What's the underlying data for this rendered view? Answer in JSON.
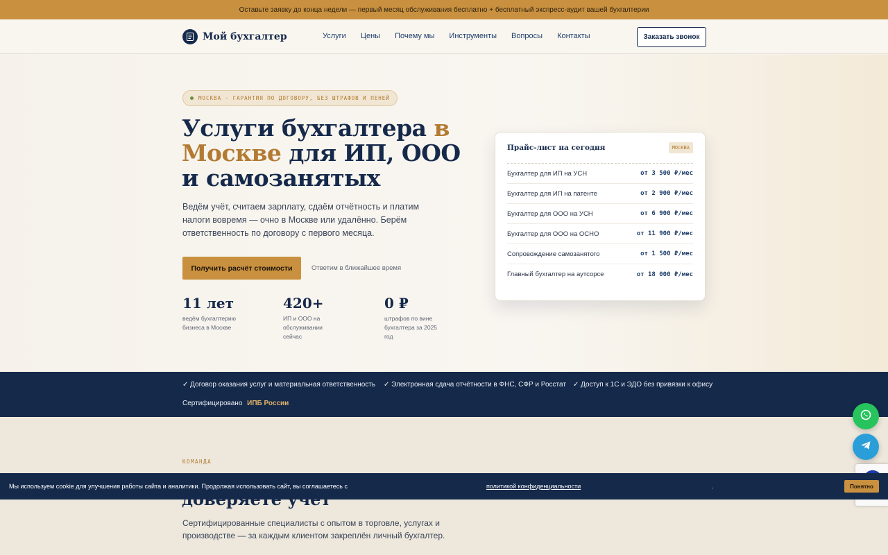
{
  "announcement": "Оставьте заявку до конца недели — первый месяц обслуживания бесплатно + бесплатный экспресс-аудит вашей бухгалтерии",
  "header": {
    "logo_text": "Мой бухгалтер",
    "nav": [
      "Услуги",
      "Цены",
      "Почему мы",
      "Инструменты",
      "Вопросы",
      "Контакты"
    ],
    "cta": "Заказать звонок"
  },
  "hero": {
    "badge": "МОСКВА · ГАРАНТИЯ ПО ДОГОВОРУ, БЕЗ ШТРАФОВ И ПЕНЕЙ",
    "title_part1": "Услуги бухгалтера ",
    "title_accent": "в Москве",
    "title_part2": " для ИП, ООО и самозанятых",
    "subtitle": "Ведём учёт, считаем зарплату, сдаём отчётность и платим налоги вовремя — очно в Москве или удалённо. Берём ответственность по договору с первого месяца.",
    "primary_button": "Получить расчёт стоимости",
    "reply_note": "Ответим в ближайшее время",
    "stats": [
      {
        "value": "11 лет",
        "caption": "ведём бухгалтерию бизнеса в Москве"
      },
      {
        "value": "420+",
        "caption": "ИП и ООО на обслуживании сейчас"
      },
      {
        "value": "0 ₽",
        "caption": "штрафов по вине бухгалтера за 2025 год"
      }
    ]
  },
  "price_card": {
    "title": "Прайс-лист на сегодня",
    "tag": "МОСКВА",
    "rows": [
      {
        "name": "Бухгалтер для ИП на УСН",
        "price": "от 3 500 ₽/мес"
      },
      {
        "name": "Бухгалтер для ИП на патенте",
        "price": "от 2 900 ₽/мес"
      },
      {
        "name": "Бухгалтер для ООО на УСН",
        "price": "от 6 900 ₽/мес"
      },
      {
        "name": "Бухгалтер для ООО на ОСНО",
        "price": "от 11 900 ₽/мес"
      },
      {
        "name": "Сопровождение самозанятого",
        "price": "от 1 500 ₽/мес"
      },
      {
        "name": "Главный бухгалтер на аутсорсе",
        "price": "от 18 000 ₽/мес"
      }
    ]
  },
  "trust": {
    "items": [
      "✓ Договор оказания услуг и материальная ответственность",
      "✓ Электронная сдача отчётности в ФНС, СФР и Росстат",
      "✓ Доступ к 1С и ЭДО без привязки к офису"
    ],
    "cert_label": "Сертифицировано",
    "cert_org": "ИПБ России"
  },
  "team": {
    "eyebrow": "КОМАНДА",
    "title": "доверяете учёт",
    "subtitle": "Сертифицированные специалисты с опытом в торговле, услугах и производстве — за каждым клиентом закреплён личный бухгалтер."
  },
  "cookie": {
    "text": "Мы используем cookie для улучшения работы сайта и аналитики. Продолжая использовать сайт, вы соглашаетесь с",
    "link": "политикой конфиденциальности",
    "dot": ".",
    "button": "Понятно"
  },
  "icons": {
    "logo": "ledger-icon",
    "whatsapp": "whatsapp-icon",
    "telegram": "telegram-icon"
  },
  "colors": {
    "brand_navy": "#15294a",
    "accent_gold": "#c9913f",
    "whatsapp_green": "#27c45d",
    "telegram_blue": "#2a9ed8"
  }
}
